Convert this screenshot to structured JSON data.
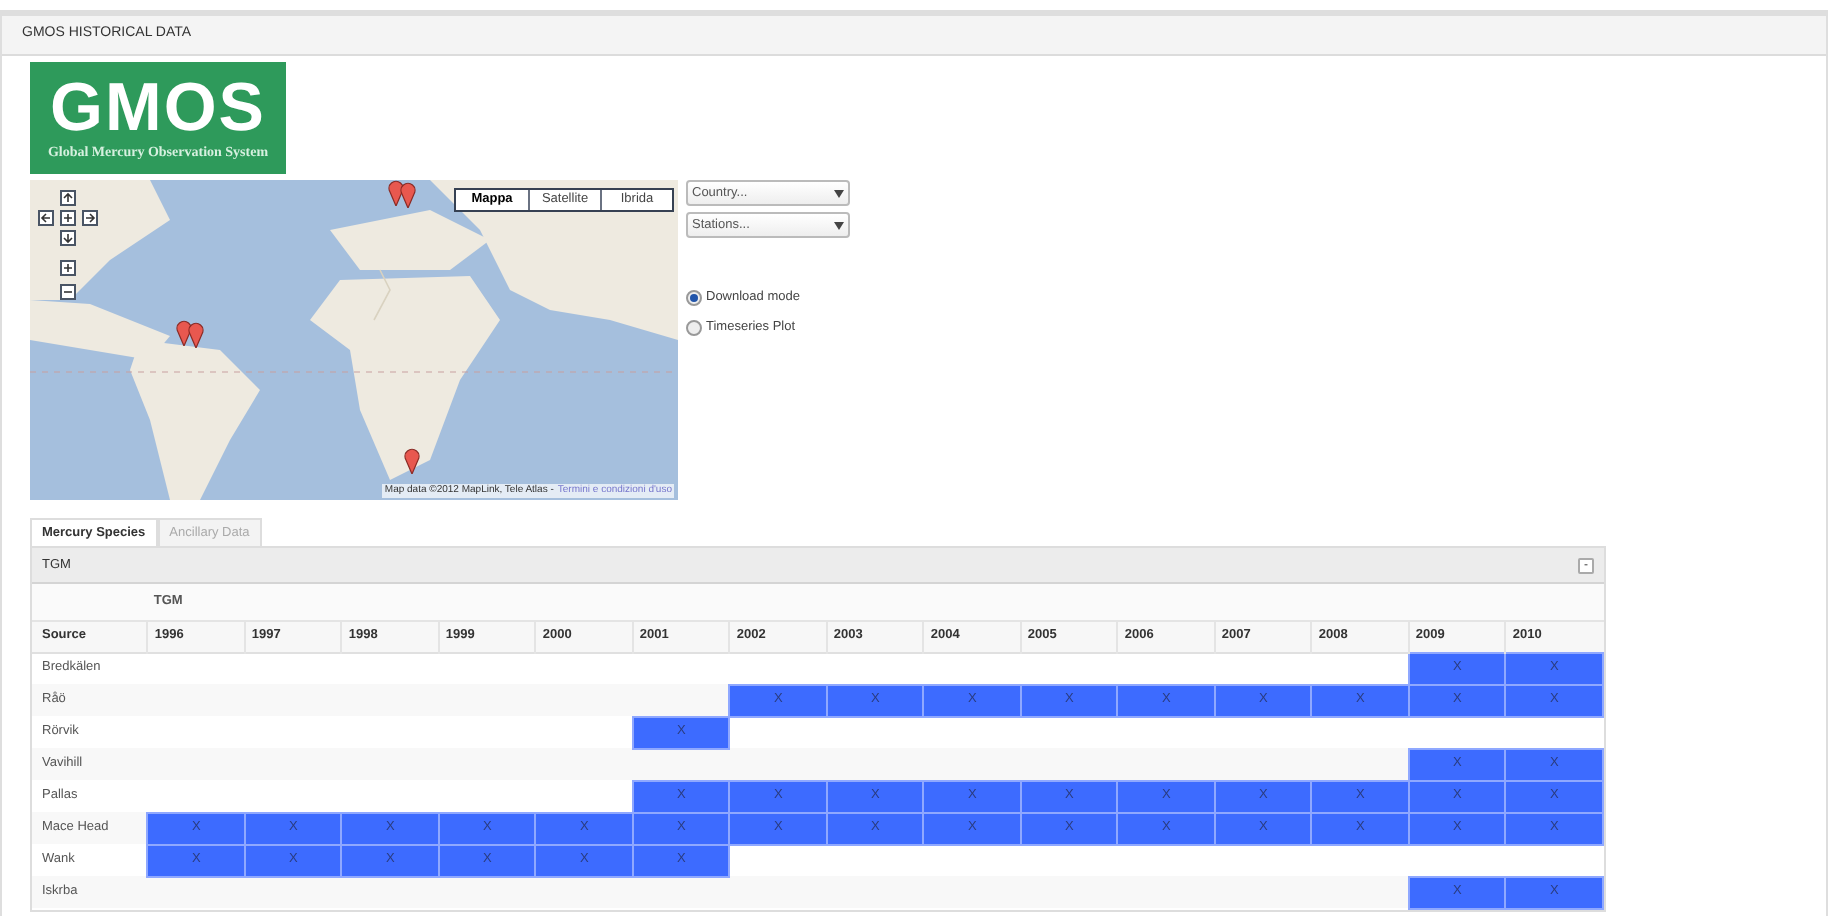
{
  "window": {
    "title": "GMOS HISTORICAL DATA"
  },
  "logo": {
    "title": "GMOS",
    "subtitle": "Global Mercury Observation System"
  },
  "map": {
    "map_types": [
      {
        "label": "Mappa",
        "selected": true
      },
      {
        "label": "Satellite",
        "selected": false
      },
      {
        "label": "Ibrida",
        "selected": false
      }
    ],
    "attribution": "Map data ©2012 MapLink, Tele Atlas -",
    "terms_link": "Termini e condizioni d'uso"
  },
  "filters": [
    {
      "placeholder": "Country..."
    },
    {
      "placeholder": "Stations..."
    }
  ],
  "modes": [
    {
      "label": "Download mode",
      "selected": true
    },
    {
      "label": "Timeseries Plot",
      "selected": false
    }
  ],
  "tabs": [
    {
      "label": "Mercury Species",
      "selected": true
    },
    {
      "label": "Ancillary Data",
      "selected": false
    }
  ],
  "panel": {
    "title": "TGM",
    "collapse": "-",
    "group_header": "TGM",
    "source_header": "Source",
    "years": [
      "1996",
      "1997",
      "1998",
      "1999",
      "2000",
      "2001",
      "2002",
      "2003",
      "2004",
      "2005",
      "2006",
      "2007",
      "2008",
      "2009",
      "2010"
    ],
    "rows": [
      {
        "source": "Bredkälen",
        "cells": [
          null,
          null,
          null,
          null,
          null,
          null,
          null,
          null,
          null,
          null,
          null,
          null,
          null,
          "X",
          "X"
        ]
      },
      {
        "source": "Råö",
        "cells": [
          null,
          null,
          null,
          null,
          null,
          null,
          "X",
          "X",
          "X",
          "X",
          "X",
          "X",
          "X",
          "X",
          "X"
        ]
      },
      {
        "source": "Rörvik",
        "cells": [
          null,
          null,
          null,
          null,
          null,
          "X",
          null,
          null,
          null,
          null,
          null,
          null,
          null,
          null,
          null
        ]
      },
      {
        "source": "Vavihill",
        "cells": [
          null,
          null,
          null,
          null,
          null,
          null,
          null,
          null,
          null,
          null,
          null,
          null,
          null,
          "X",
          "X"
        ]
      },
      {
        "source": "Pallas",
        "cells": [
          null,
          null,
          null,
          null,
          null,
          "X",
          "X",
          "X",
          "X",
          "X",
          "X",
          "X",
          "X",
          "X",
          "X"
        ]
      },
      {
        "source": "Mace Head",
        "cells": [
          "X",
          "X",
          "X",
          "X",
          "X",
          "X",
          "X",
          "X",
          "X",
          "X",
          "X",
          "X",
          "X",
          "X",
          "X"
        ]
      },
      {
        "source": "Wank",
        "cells": [
          "X",
          "X",
          "X",
          "X",
          "X",
          "X",
          null,
          null,
          null,
          null,
          null,
          null,
          null,
          null,
          null
        ]
      },
      {
        "source": "Iskrba",
        "cells": [
          null,
          null,
          null,
          null,
          null,
          null,
          null,
          null,
          null,
          null,
          null,
          null,
          null,
          "X",
          "X"
        ]
      }
    ]
  }
}
